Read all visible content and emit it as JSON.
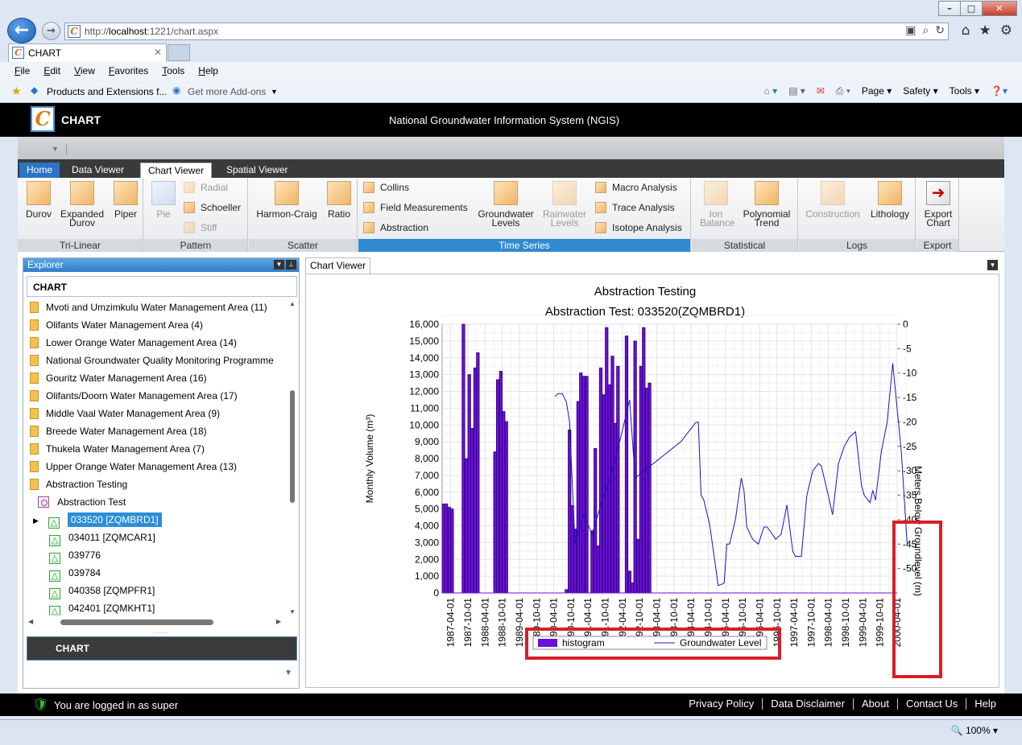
{
  "browser": {
    "url_prefix": "http://",
    "url_host": "localhost",
    "url_rest": ":1221/chart.aspx",
    "tab_title": "CHART",
    "favicon_letter": "C",
    "menu": [
      "File",
      "Edit",
      "View",
      "Favorites",
      "Tools",
      "Help"
    ],
    "favorites": [
      "Products and Extensions f...",
      "Get more Add-ons"
    ],
    "command_bar": [
      "Page",
      "Safety",
      "Tools"
    ],
    "zoom": "100%"
  },
  "app": {
    "name": "CHART",
    "logo_letter": "C",
    "system_title": "National Groundwater Information System (NGIS)"
  },
  "ribbon": {
    "tabs": [
      "Home",
      "Data Viewer",
      "Chart Viewer",
      "Spatial Viewer"
    ],
    "groups": {
      "tri_linear": "Tri-Linear",
      "pattern": "Pattern",
      "scatter": "Scatter",
      "time_series": "Time Series",
      "statistical": "Statistical",
      "logs": "Logs",
      "export": "Export"
    },
    "buttons": {
      "durov": "Durov",
      "expanded_durov_1": "Expanded",
      "expanded_durov_2": "Durov",
      "piper": "Piper",
      "pie": "Pie",
      "radial": "Radial",
      "schoeller": "Schoeller",
      "stiff": "Stiff",
      "harmon_craig": "Harmon-Craig",
      "ratio": "Ratio",
      "collins": "Collins",
      "field_measurements": "Field Measurements",
      "abstraction": "Abstraction",
      "groundwater_levels_1": "Groundwater",
      "groundwater_levels_2": "Levels",
      "rainwater_levels_1": "Rainwater",
      "rainwater_levels_2": "Levels",
      "macro_analysis": "Macro Analysis",
      "trace_analysis": "Trace Analysis",
      "isotope_analysis": "Isotope Analysis",
      "ion_balance_1": "Ion",
      "ion_balance_2": "Balance",
      "polynomial_trend_1": "Polynomial",
      "polynomial_trend_2": "Trend",
      "construction": "Construction",
      "lithology": "Lithology",
      "export_chart_1": "Export",
      "export_chart_2": "Chart"
    }
  },
  "explorer": {
    "title": "Explorer",
    "header": "CHART",
    "items": [
      "Mvoti and Umzimkulu Water Management Area (11)",
      "Olifants Water Management Area (4)",
      "Lower Orange Water Management Area (14)",
      "National Groundwater Quality Monitoring Programme",
      "Gouritz Water Management Area (16)",
      "Olifants/Doorn Water Management Area (17)",
      "Middle Vaal Water Management Area (9)",
      "Breede Water Management Area (18)",
      "Thukela Water Management Area (7)",
      "Upper Orange Water Management Area  (13)",
      "Abstraction Testing"
    ],
    "sub_item": "Abstraction Test",
    "sites": [
      "033520 [ZQMBRD1]",
      "034011 [ZQMCAR1]",
      "039776",
      "039784",
      "040358 [ZQMPFR1]",
      "042401 [ZQMKHT1]"
    ],
    "footer": "CHART"
  },
  "viewer": {
    "tab": "Chart Viewer"
  },
  "chart_data": {
    "type": "bar+line",
    "title": "Abstraction Testing",
    "subtitle": "Abstraction Test: 033520(ZQMBRD1)",
    "ylabel": "Monthly Volume (m³)",
    "y2label": "Meters Below Groundlevel (m)",
    "ylim": [
      0,
      16000
    ],
    "y2lim": [
      0,
      -55
    ],
    "y_ticks": [
      "0",
      "1,000",
      "2,000",
      "3,000",
      "4,000",
      "5,000",
      "6,000",
      "7,000",
      "8,000",
      "9,000",
      "10,000",
      "11,000",
      "12,000",
      "13,000",
      "14,000",
      "15,000",
      "16,000"
    ],
    "y2_ticks": [
      "0",
      "-5",
      "-10",
      "-15",
      "-20",
      "-25",
      "-30",
      "-35",
      "-40",
      "-45",
      "-50"
    ],
    "x_ticks": [
      "1987-04-01",
      "1987-10-01",
      "1988-04-01",
      "1988-10-01",
      "1989-04-01",
      "1989-10-01",
      "1990-04-01",
      "1990-10-01",
      "1991-04-01",
      "1991-10-01",
      "1992-04-01",
      "1992-10-01",
      "1993-04-01",
      "1993-10-01",
      "1994-04-01",
      "1994-10-01",
      "1995-04-01",
      "1995-10-01",
      "1996-04-01",
      "1996-10-01",
      "1997-04-01",
      "1997-10-01",
      "1998-04-01",
      "1998-10-01",
      "1999-04-01",
      "1999-10-01",
      "2000-04-01"
    ],
    "xlim": [
      1987.0,
      2000.25
    ],
    "bar_series": {
      "name": "histogram",
      "color": "#6a0fdd",
      "bars": [
        [
          1987.04,
          5300
        ],
        [
          1987.12,
          5300
        ],
        [
          1987.21,
          5100
        ],
        [
          1987.29,
          5000
        ],
        [
          1987.62,
          16000
        ],
        [
          1987.71,
          8000
        ],
        [
          1987.79,
          13000
        ],
        [
          1987.87,
          9800
        ],
        [
          1987.96,
          13400
        ],
        [
          1988.04,
          14300
        ],
        [
          1988.54,
          8400
        ],
        [
          1988.62,
          12700
        ],
        [
          1988.71,
          13200
        ],
        [
          1988.79,
          10800
        ],
        [
          1988.87,
          10200
        ],
        [
          1990.62,
          200
        ],
        [
          1990.71,
          9700
        ],
        [
          1990.79,
          5200
        ],
        [
          1990.87,
          3800
        ],
        [
          1990.96,
          11400
        ],
        [
          1991.04,
          13100
        ],
        [
          1991.12,
          12900
        ],
        [
          1991.21,
          12900
        ],
        [
          1991.37,
          3700
        ],
        [
          1991.46,
          8600
        ],
        [
          1991.54,
          2800
        ],
        [
          1991.62,
          13400
        ],
        [
          1991.71,
          11800
        ],
        [
          1991.79,
          15800
        ],
        [
          1991.87,
          12400
        ],
        [
          1991.96,
          14100
        ],
        [
          1992.04,
          10100
        ],
        [
          1992.12,
          13500
        ],
        [
          1992.37,
          15300
        ],
        [
          1992.46,
          1300
        ],
        [
          1992.54,
          600
        ],
        [
          1992.62,
          15000
        ],
        [
          1992.71,
          3200
        ],
        [
          1992.79,
          13500
        ],
        [
          1992.87,
          15800
        ],
        [
          1992.96,
          12200
        ],
        [
          1993.04,
          12500
        ]
      ]
    },
    "line_series": {
      "name": "Groundwater Level",
      "color": "#1515c8",
      "points": [
        [
          1990.29,
          -14.8
        ],
        [
          1990.37,
          -14.2
        ],
        [
          1990.5,
          -14.2
        ],
        [
          1990.62,
          -16
        ],
        [
          1990.71,
          -20
        ],
        [
          1990.87,
          -45
        ],
        [
          1991.12,
          -39
        ],
        [
          1991.37,
          -43
        ],
        [
          1991.62,
          -37
        ],
        [
          1991.87,
          -32
        ],
        [
          1992.12,
          -25.5
        ],
        [
          1992.46,
          -15.5
        ],
        [
          1992.62,
          -31.5
        ],
        [
          1993.96,
          -24
        ],
        [
          1994.12,
          -22.5
        ],
        [
          1994.29,
          -21
        ],
        [
          1994.37,
          -20.2
        ],
        [
          1994.46,
          -20
        ],
        [
          1994.54,
          -35
        ],
        [
          1994.62,
          -36
        ],
        [
          1994.79,
          -41
        ],
        [
          1995.04,
          -53.5
        ],
        [
          1995.21,
          -53
        ],
        [
          1995.29,
          -45
        ],
        [
          1995.37,
          -45
        ],
        [
          1995.54,
          -40
        ],
        [
          1995.71,
          -31.5
        ],
        [
          1995.79,
          -34
        ],
        [
          1995.87,
          -41.5
        ],
        [
          1996.04,
          -44
        ],
        [
          1996.21,
          -45
        ],
        [
          1996.37,
          -41.5
        ],
        [
          1996.46,
          -41.5
        ],
        [
          1996.62,
          -43
        ],
        [
          1996.71,
          -44
        ],
        [
          1996.87,
          -43
        ],
        [
          1997.04,
          -37
        ],
        [
          1997.12,
          -41.5
        ],
        [
          1997.21,
          -46.5
        ],
        [
          1997.29,
          -47.5
        ],
        [
          1997.46,
          -47.5
        ],
        [
          1997.62,
          -35
        ],
        [
          1997.79,
          -30
        ],
        [
          1997.96,
          -28.5
        ],
        [
          1998.04,
          -29
        ],
        [
          1998.21,
          -34
        ],
        [
          1998.37,
          -39
        ],
        [
          1998.54,
          -28.5
        ],
        [
          1998.71,
          -25
        ],
        [
          1998.87,
          -23
        ],
        [
          1999.04,
          -22
        ],
        [
          1999.21,
          -33
        ],
        [
          1999.29,
          -35
        ],
        [
          1999.46,
          -36.5
        ],
        [
          1999.54,
          -34
        ],
        [
          1999.62,
          -36
        ],
        [
          1999.79,
          -26
        ],
        [
          1999.96,
          -20
        ],
        [
          2000.12,
          -8
        ],
        [
          2000.37,
          -26
        ],
        [
          2000.54,
          -45
        ]
      ]
    },
    "legend": [
      "histogram",
      "Groundwater Level"
    ],
    "legend_position": "bottom"
  },
  "status": {
    "login": "You are logged in as super",
    "links": [
      "Privacy Policy",
      "Data Disclaimer",
      "About",
      "Contact Us",
      "Help"
    ]
  }
}
